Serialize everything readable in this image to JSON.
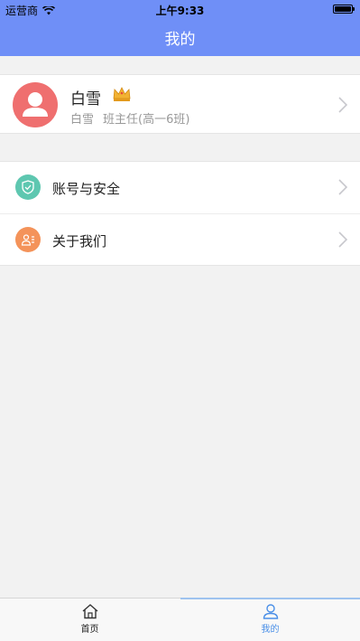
{
  "status_bar": {
    "carrier": "运营商",
    "time": "上午9:33"
  },
  "header": {
    "title": "我的"
  },
  "profile": {
    "name": "白雪",
    "sub_name": "白雪",
    "role": "班主任(高一6班)"
  },
  "menu": [
    {
      "label": "账号与安全",
      "icon": "shield-icon",
      "color": "#5ec7b0"
    },
    {
      "label": "关于我们",
      "icon": "contact-card-icon",
      "color": "#f4935a"
    }
  ],
  "tabs": [
    {
      "label": "首页",
      "icon": "home-icon"
    },
    {
      "label": "我的",
      "icon": "user-icon",
      "active": true
    }
  ],
  "colors": {
    "header": "#6f8ff7",
    "avatar": "#ef6f6f",
    "active_tab": "#4a8fe7"
  }
}
